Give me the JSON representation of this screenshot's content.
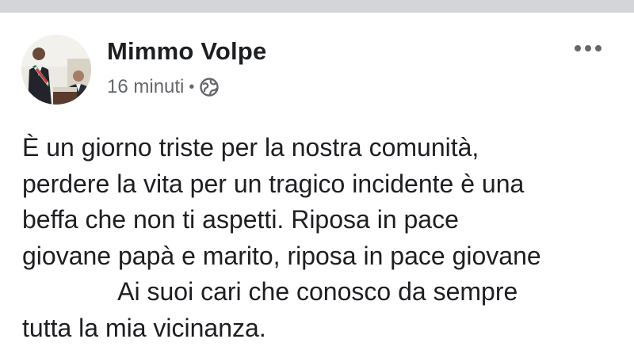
{
  "post": {
    "author": "Mimmo Volpe",
    "time": "16 minuti",
    "separator": "•",
    "privacy_icon": "globe-icon",
    "more_icon": "more-options-icon",
    "lines": [
      "È un giorno triste per la nostra comunità,",
      "perdere la vita per un tragico incidente è una",
      "beffa che non ti aspetti. Riposa in pace",
      "giovane papà e marito, riposa in pace giovane",
      "Ai suoi cari che conosco da sempre",
      "tutta la mia vicinanza."
    ]
  },
  "colors": {
    "text": "#1c1e21",
    "secondary": "#65676b",
    "top_strip": "#d3d5d9"
  }
}
